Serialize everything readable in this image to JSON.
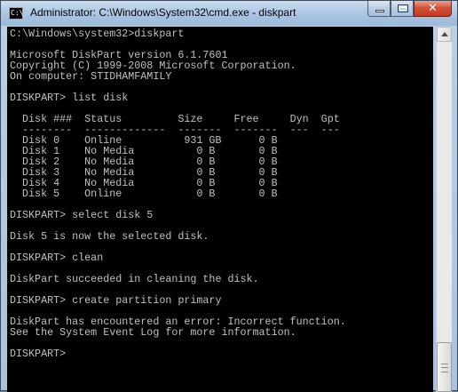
{
  "window": {
    "title": "Administrator: C:\\Windows\\System32\\cmd.exe - diskpart",
    "icon_label": "C:\\",
    "buttons": {
      "minimize": "minimize",
      "maximize": "maximize",
      "close": "✕"
    }
  },
  "console": {
    "lines": [
      "C:\\Windows\\system32>diskpart",
      "",
      "Microsoft DiskPart version 6.1.7601",
      "Copyright (C) 1999-2008 Microsoft Corporation.",
      "On computer: STIDHAMFAMILY",
      "",
      "DISKPART> list disk",
      "",
      "  Disk ###  Status         Size     Free     Dyn  Gpt",
      "  --------  -------------  -------  -------  ---  ---",
      "  Disk 0    Online          931 GB      0 B",
      "  Disk 1    No Media          0 B       0 B",
      "  Disk 2    No Media          0 B       0 B",
      "  Disk 3    No Media          0 B       0 B",
      "  Disk 4    No Media          0 B       0 B",
      "  Disk 5    Online            0 B       0 B",
      "",
      "DISKPART> select disk 5",
      "",
      "Disk 5 is now the selected disk.",
      "",
      "DISKPART> clean",
      "",
      "DiskPart succeeded in cleaning the disk.",
      "",
      "DISKPART> create partition primary",
      "",
      "DiskPart has encountered an error: Incorrect function.",
      "See the System Event Log for more information.",
      "",
      "DISKPART>"
    ]
  },
  "colors": {
    "console_bg": "#000000",
    "console_fg": "#c0c0c0",
    "close_button": "#c33a24"
  }
}
